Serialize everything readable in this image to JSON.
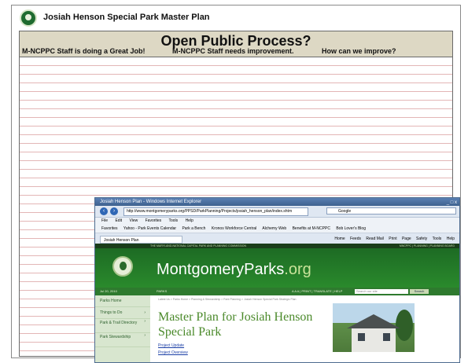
{
  "header": {
    "title": "Josiah Henson Special Park Master Plan"
  },
  "board": {
    "title": "Open Public Process?",
    "columns": [
      "M-NCPPC Staff is doing a Great Job!",
      "M-NCPPC Staff needs improvement.",
      "How can we improve?"
    ]
  },
  "browser": {
    "window_title": "Josiah Henson Plan - Windows Internet Explorer",
    "window_controls": "_ □ x",
    "address": "http://www.montgomeryparks.org/PPSD/ParkPlanning/Projects/josiah_henson_plan/index.shtm",
    "search_placeholder": "Google",
    "menu": [
      "File",
      "Edit",
      "View",
      "Favorites",
      "Tools",
      "Help"
    ],
    "favorites": [
      "Favorites",
      "Yahoo - Park Events Calendar",
      "Park a Bench",
      "Kronos Workforce Central",
      "Alchemy Web",
      "Benefits at M-NCPPC",
      "Bob Lover's Blog"
    ],
    "tab": "Josiah Henson Plan",
    "toolbar": [
      "Home",
      "Feeds",
      "Read Mail",
      "Print",
      "Page",
      "Safety",
      "Tools",
      "Help"
    ]
  },
  "site": {
    "top_banner": "THE MARYLAND-NATIONAL CAPITAL PARK AND PLANNING COMMISSION",
    "top_links": "MNCPPC | PLANNING | PLANNING BOARD",
    "brand_main": "MontgomeryParks",
    "brand_suffix": ".org",
    "date": "Jul 20, 2010",
    "nav_label": "PARKS",
    "utility_links": "A A A | PRINT | TRANSLATE | HELP",
    "search_placeholder": "Search our site",
    "search_button": "Search",
    "sidebar": [
      "Parks Home",
      "Things to Do",
      "Park & Trail Directory",
      "Park Stewardship"
    ],
    "breadcrumb": "Latest Us > Parks Home > Planning & Stewardship > Park Planning > Josiah Henson Special Park Strategic Plan",
    "page_title": "Master Plan for Josiah Henson Special Park",
    "links": [
      "Project Update",
      "Project Overview"
    ]
  },
  "colors": {
    "banner": "#ddd8c4",
    "ruled_line": "#e3b6b6",
    "parks_green": "#2a8a2c",
    "title_green": "#4b8a2b"
  }
}
